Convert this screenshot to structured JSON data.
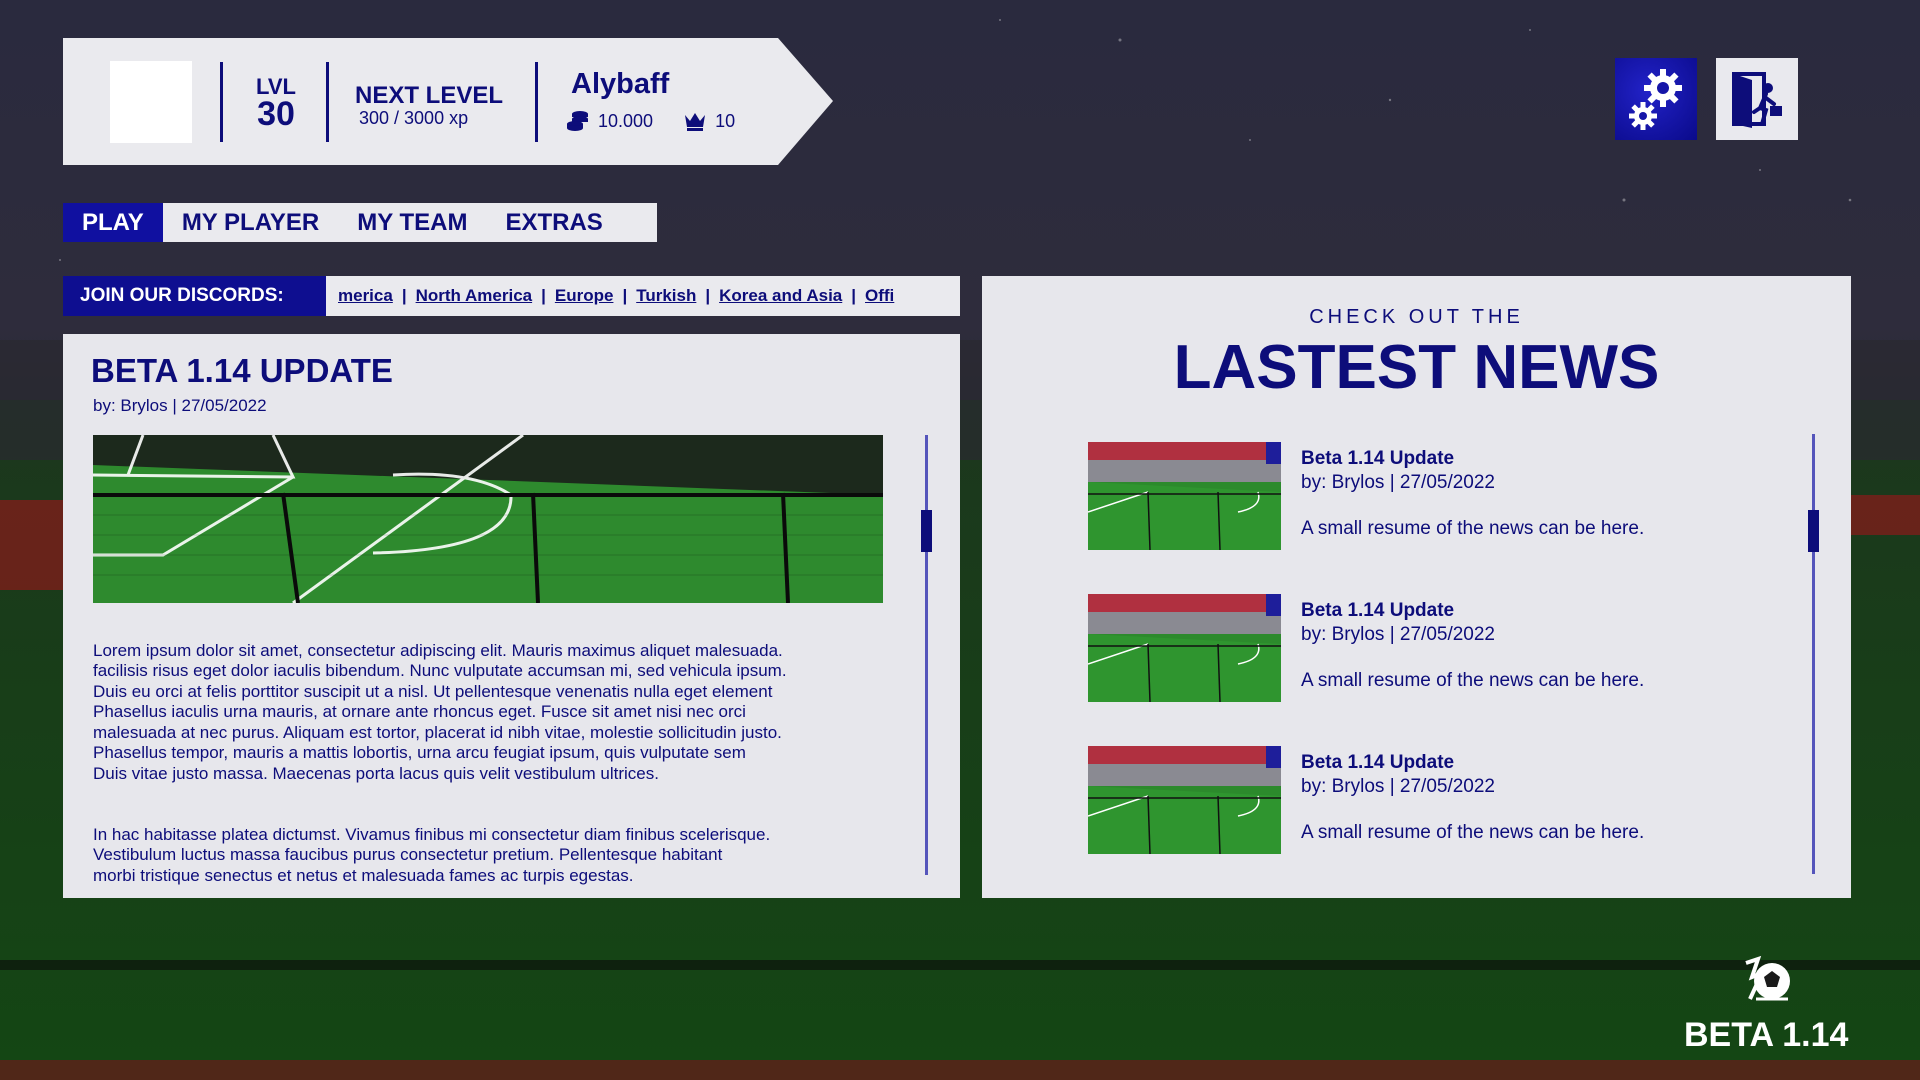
{
  "header": {
    "level_label": "LVL",
    "level_value": "30",
    "next_level_title": "NEXT LEVEL",
    "next_level_xp": "300 / 3000 xp",
    "username": "Alybaff",
    "coins": "10.000",
    "crowns": "10",
    "coins_icon": "coins-stack-icon",
    "crowns_icon": "crown-icon"
  },
  "top_buttons": {
    "settings_icon": "gears-icon",
    "exit_icon": "exit-door-icon"
  },
  "tabs": [
    {
      "label": "PLAY",
      "active": true
    },
    {
      "label": "MY PLAYER",
      "active": false
    },
    {
      "label": "MY TEAM",
      "active": false
    },
    {
      "label": "EXTRAS",
      "active": false
    }
  ],
  "discord": {
    "label": "JOIN OUR DISCORDS:",
    "links": [
      "merica",
      "North America",
      "Europe",
      "Turkish",
      "Korea and Asia",
      "Offi"
    ],
    "separator": "|"
  },
  "article": {
    "title": "BETA 1.14 UPDATE",
    "meta": "by: Brylos  |  27/05/2022",
    "paragraph1": "Lorem ipsum dolor sit amet, consectetur adipiscing elit. Mauris maximus aliquet malesuada.\nfacilisis risus eget dolor iaculis bibendum. Nunc vulputate accumsan mi, sed vehicula ipsum.\nDuis eu orci at felis porttitor suscipit ut a nisl. Ut pellentesque venenatis nulla eget element\nPhasellus iaculis urna mauris, at ornare ante rhoncus eget. Fusce sit amet nisi nec orci\n malesuada at nec purus. Aliquam est tortor, placerat id nibh vitae, molestie sollicitudin justo.\nPhasellus tempor, mauris a mattis lobortis, urna arcu feugiat ipsum, quis vulputate sem\nDuis vitae justo massa. Maecenas porta lacus quis velit vestibulum ultrices.",
    "paragraph2": "In hac habitasse platea dictumst. Vivamus finibus mi consectetur diam finibus scelerisque.\nVestibulum luctus massa faucibus purus consectetur pretium. Pellentesque habitant\nmorbi tristique senectus et netus et malesuada fames ac turpis egestas."
  },
  "news": {
    "kicker": "CHECK OUT THE",
    "heading": "LASTEST NEWS",
    "items": [
      {
        "title": "Beta 1.14 Update",
        "meta": "by: Brylos  |  27/05/2022",
        "summary": "A small resume of the news can be here."
      },
      {
        "title": "Beta 1.14 Update",
        "meta": "by: Brylos  |  27/05/2022",
        "summary": "A small resume of the news can be here."
      },
      {
        "title": "Beta 1.14 Update",
        "meta": "by: Brylos  |  27/05/2022",
        "summary": "A small resume of the news can be here."
      }
    ]
  },
  "brand": {
    "version": "BETA 1.14",
    "logo_icon": "soccer-ball-logo-icon"
  },
  "colors": {
    "accent": "#0d0d7a",
    "active_tab": "#1010a0",
    "card_bg": "#e7e7ec",
    "pitch_green": "#2a7a2a"
  }
}
